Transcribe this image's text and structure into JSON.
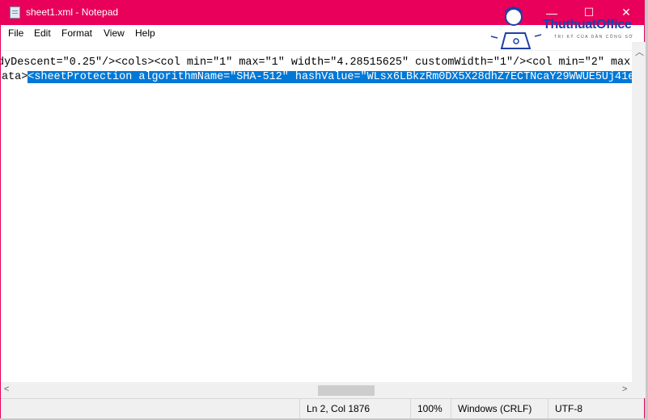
{
  "window": {
    "title": "sheet1.xml - Notepad",
    "accent_color": "#e8005a",
    "controls": {
      "minimize": "—",
      "maximize": "☐",
      "close": "✕"
    }
  },
  "watermark": {
    "brand": "ThuthuatOffice",
    "tagline": "TRI KỶ CỦA DÂN CÔNG SỞ"
  },
  "menu": [
    "File",
    "Edit",
    "Format",
    "View",
    "Help"
  ],
  "editor": {
    "lines": [
      {
        "text": "dyDescent=\"0.25\"/><cols><col min=\"1\" max=\"1\" width=\"4.28515625\" customWidth=\"1\"/><col min=\"2\" max",
        "selected": ""
      },
      {
        "text": "ata>",
        "selected": "<sheetProtection algorithmName=\"SHA-512\" hashValue=\"WLsx6LBkzRm0DX5X28dhZ7ECTNcaY29WWUE5Uj41e"
      }
    ],
    "selection_color": "#0078d7"
  },
  "status": {
    "position": "Ln 2, Col 1876",
    "zoom": "100%",
    "line_ending": "Windows (CRLF)",
    "encoding": "UTF-8"
  }
}
